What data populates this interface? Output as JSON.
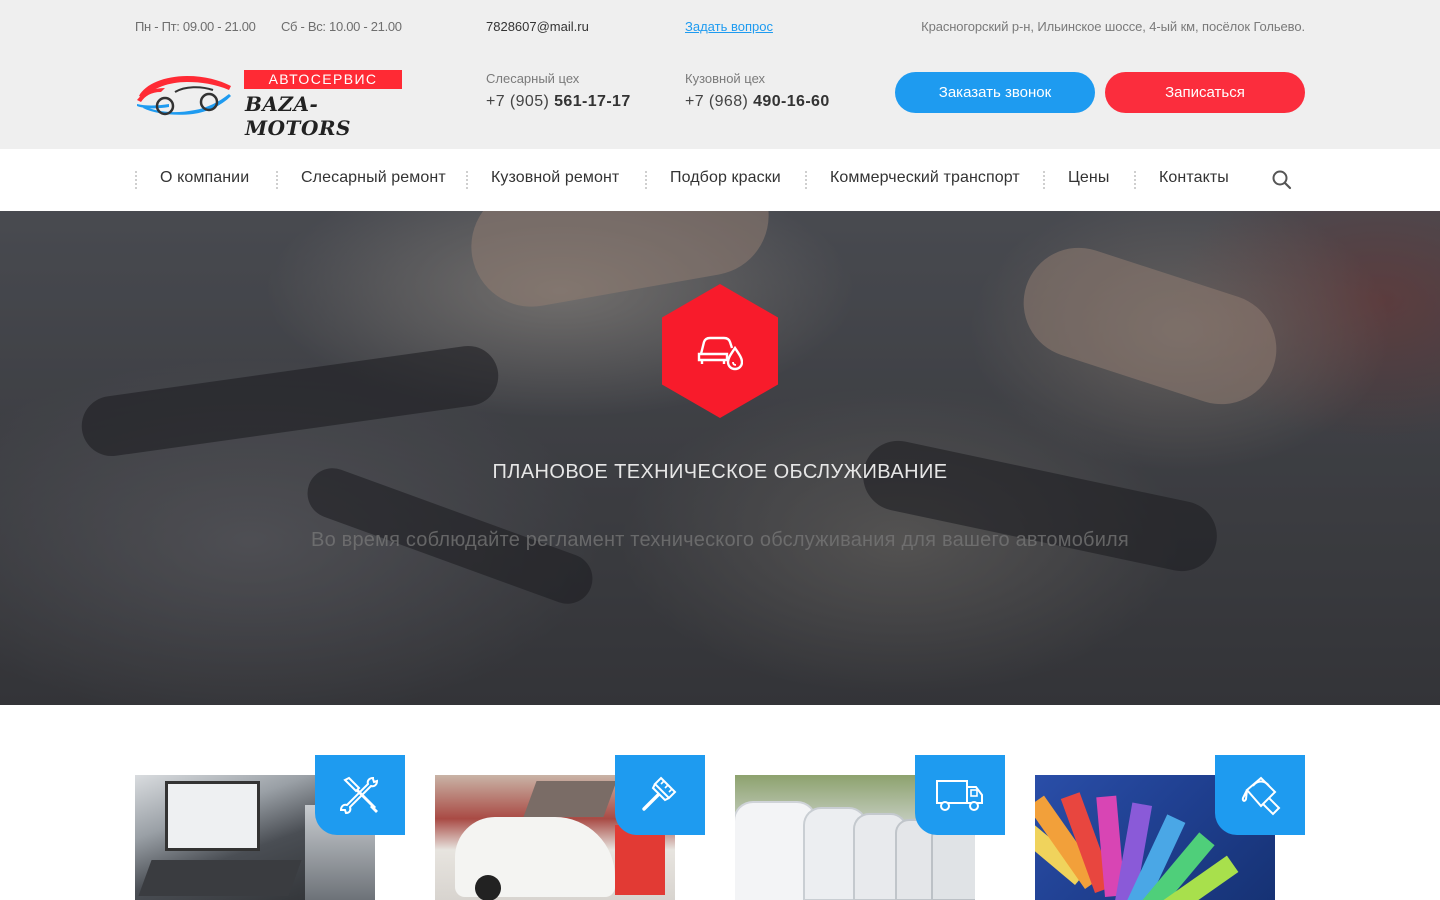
{
  "header": {
    "hours_weekday": "Пн - Пт: 09.00 - 21.00",
    "hours_weekend": "Сб - Вс: 10.00 - 21.00",
    "email": "7828607@mail.ru",
    "ask_link": "Задать вопрос",
    "address": "Красногорский р-н, Ильинское шоссе, 4-ый км, посёлок Гольево.",
    "logo_top": "АВТОСЕРВИС",
    "logo_bottom": "BAZA-MOTORS",
    "phones": [
      {
        "label": "Слесарный цех",
        "prefix": "+7 (905) ",
        "number": "561-17-17"
      },
      {
        "label": "Кузовной цех",
        "prefix": "+7 (968) ",
        "number": "490-16-60"
      }
    ],
    "btn_call": "Заказать звонок",
    "btn_signup": "Записаться"
  },
  "nav": {
    "items": [
      "О компании",
      "Слесарный ремонт",
      "Кузовной ремонт",
      "Подбор краски",
      "Коммерческий транспорт",
      "Цены",
      "Контакты"
    ],
    "search_icon": "search-icon"
  },
  "hero": {
    "icon": "car-oil-drop-icon",
    "title": "ПЛАНОВОЕ ТЕХНИЧЕСКОЕ ОБСЛУЖИВАНИЕ",
    "subtitle": "Во время соблюдайте регламент технического обслуживания для вашего автомобиля"
  },
  "cards": [
    {
      "icon": "wrench-screwdriver-icon"
    },
    {
      "icon": "paint-brush-icon"
    },
    {
      "icon": "truck-icon"
    },
    {
      "icon": "paint-bucket-icon"
    }
  ],
  "colors": {
    "accent_blue": "#1e9bf0",
    "accent_red": "#fb2d3d",
    "header_bg": "#efefef"
  }
}
